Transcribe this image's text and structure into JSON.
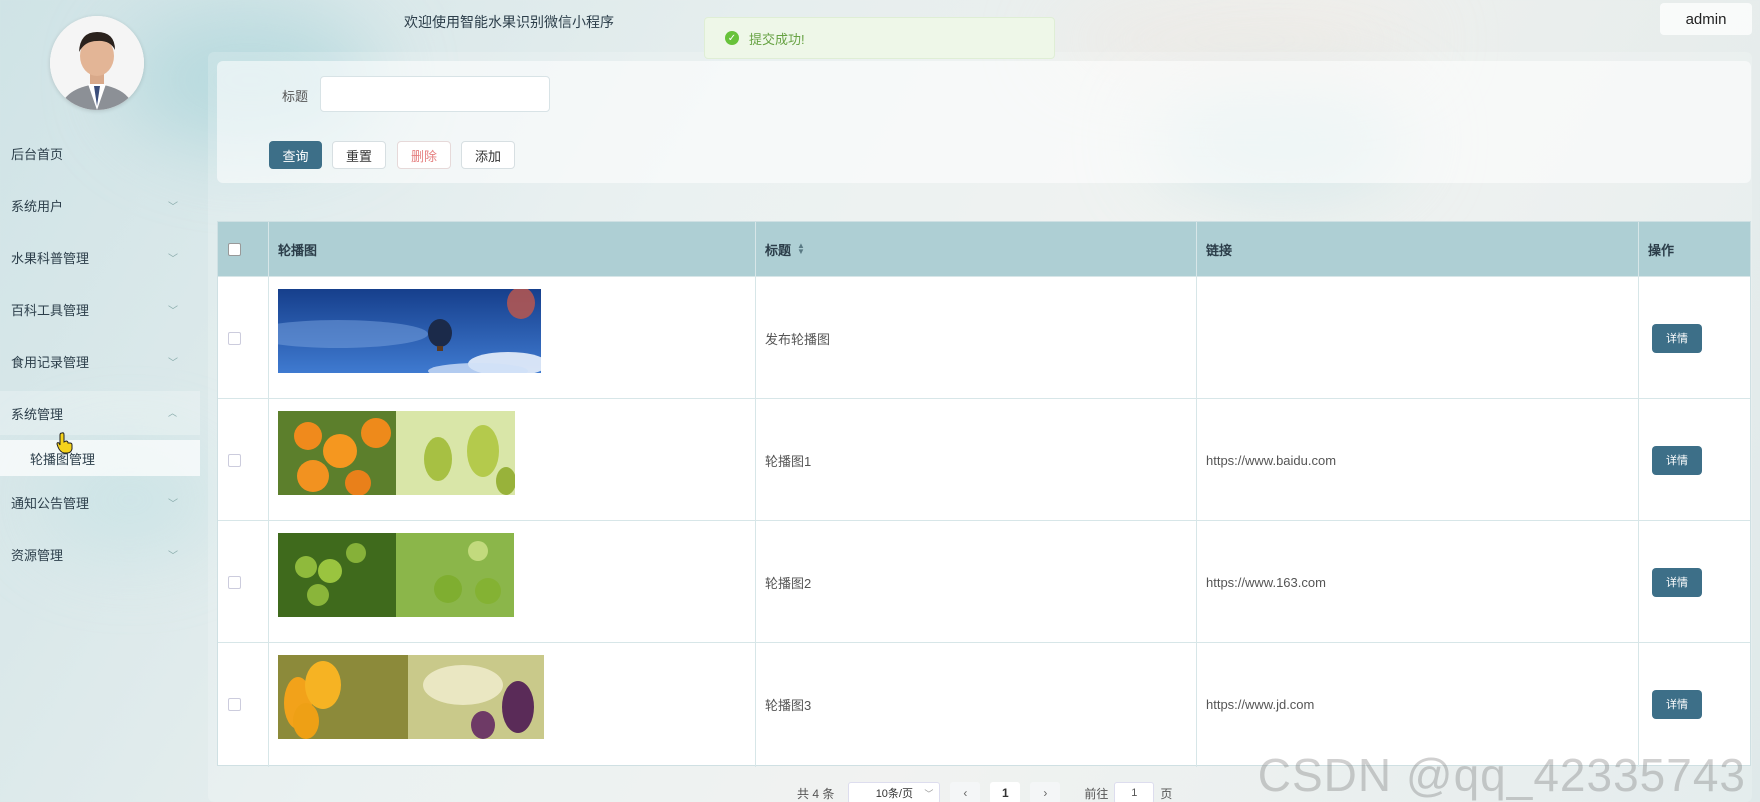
{
  "header": {
    "welcome": "欢迎使用智能水果识别微信小程序",
    "user": "admin"
  },
  "toast": {
    "message": "提交成功!",
    "icon": "check-circle-icon",
    "color": "#67c23a"
  },
  "sidebar": {
    "items": [
      {
        "label": "后台首页"
      },
      {
        "label": "系统用户"
      },
      {
        "label": "水果科普管理"
      },
      {
        "label": "百科工具管理"
      },
      {
        "label": "食用记录管理"
      },
      {
        "label": "系统管理"
      },
      {
        "label": "通知公告管理"
      },
      {
        "label": "资源管理"
      }
    ],
    "submenu": {
      "label": "轮播图管理"
    }
  },
  "search": {
    "label": "标题",
    "value": "",
    "buttons": {
      "query": "查询",
      "reset": "重置",
      "delete": "删除",
      "add": "添加"
    }
  },
  "table": {
    "columns": {
      "image": "轮播图",
      "title": "标题",
      "link": "链接",
      "action": "操作"
    },
    "rows": [
      {
        "title": "发布轮播图",
        "link": "",
        "action": "详情"
      },
      {
        "title": "轮播图1",
        "link": "https://www.baidu.com",
        "action": "详情"
      },
      {
        "title": "轮播图2",
        "link": "https://www.163.com",
        "action": "详情"
      },
      {
        "title": "轮播图3",
        "link": "https://www.jd.com",
        "action": "详情"
      }
    ]
  },
  "pagination": {
    "total": "共 4 条",
    "page_size": "10条/页",
    "current": "1",
    "goto_prefix": "前往",
    "goto_value": "1",
    "goto_suffix": "页"
  },
  "watermark": "CSDN @qq_42335743",
  "colors": {
    "primary": "#3d6f88",
    "header_bg": "#aecfd4",
    "danger_text": "#e57f7f"
  }
}
